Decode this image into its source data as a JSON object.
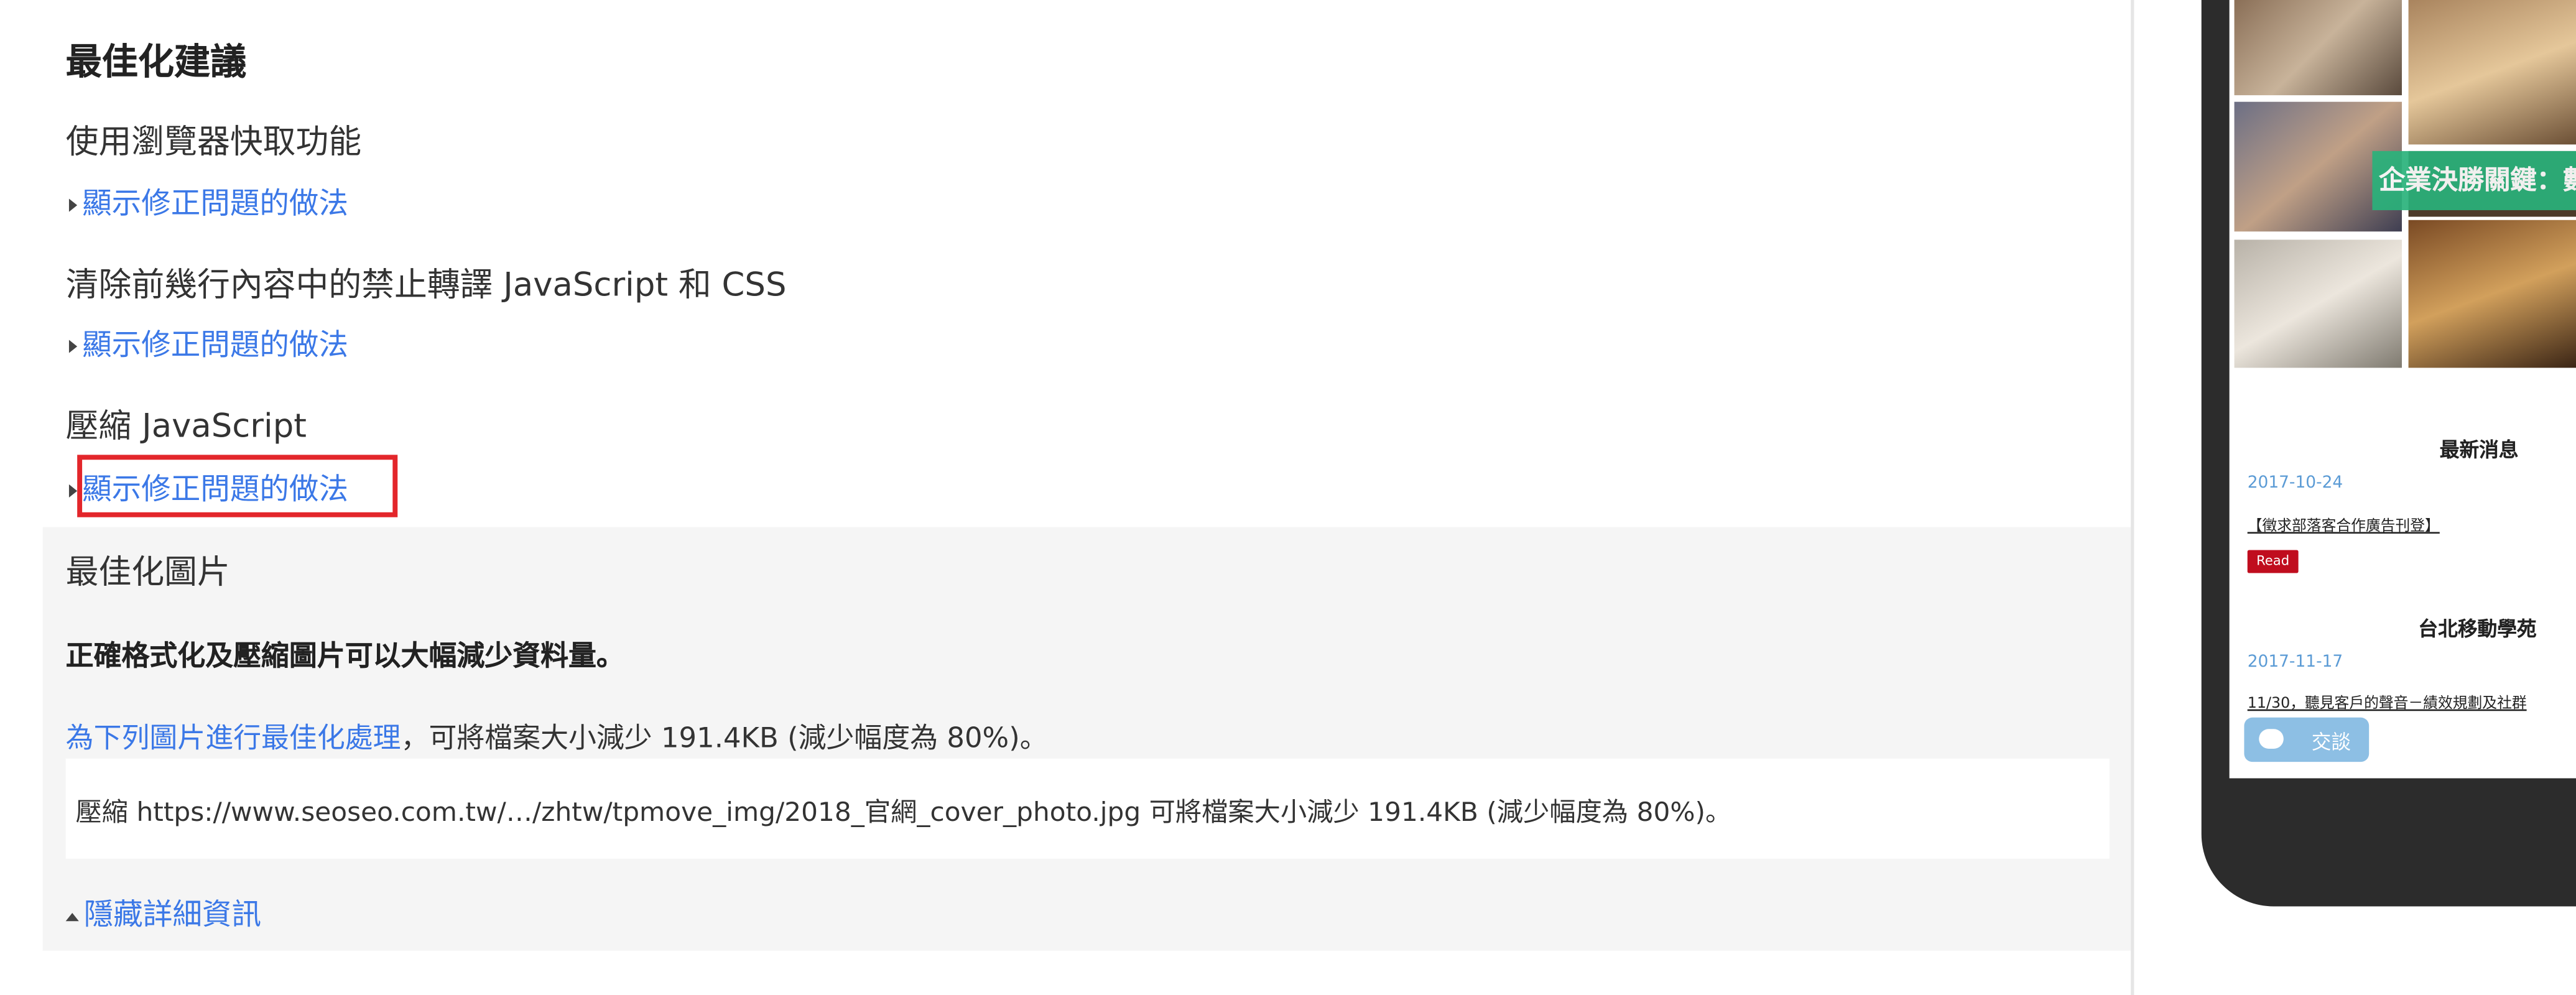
{
  "left_panel": {
    "section_title": "最佳化建議",
    "rules": [
      {
        "title": "使用瀏覽器快取功能",
        "toggle": "顯示修正問題的做法"
      },
      {
        "title": "清除前幾行內容中的禁止轉譯 JavaScript 和 CSS",
        "toggle": "顯示修正問題的做法"
      },
      {
        "title": "壓縮 JavaScript",
        "toggle": "顯示修正問題的做法"
      }
    ],
    "expanded": {
      "title": "最佳化圖片",
      "summary": "正確格式化及壓縮圖片可以大幅減少資料量。",
      "link": "為下列圖片進行最佳化處理",
      "after_link": "，可將檔案大小減少 191.4KB (減少幅度為 80%)。",
      "detail": "壓縮 https://www.seoseo.com.tw/…/zhtw/tpmove_img/2018_官網_cover_photo.jpg 可將檔案大小減少 191.4KB (減少幅度為 80%)。",
      "hide": "隱藏詳細資訊"
    },
    "highlight_color": "#e3262b",
    "link_color": "#3b78e7"
  },
  "phone": {
    "banner": "企業決勝關鍵：數據",
    "news_heading": "最新消息",
    "news": {
      "date": "2017-10-24",
      "title": "【徵求部落客合作廣告刊登】",
      "badge": "Read"
    },
    "school_heading": "台北移動學苑",
    "school": {
      "date": "2017-11-17",
      "title": "11/30，聽見客戶的聲音－績效規劃及社群"
    },
    "chat_label": "交談"
  }
}
